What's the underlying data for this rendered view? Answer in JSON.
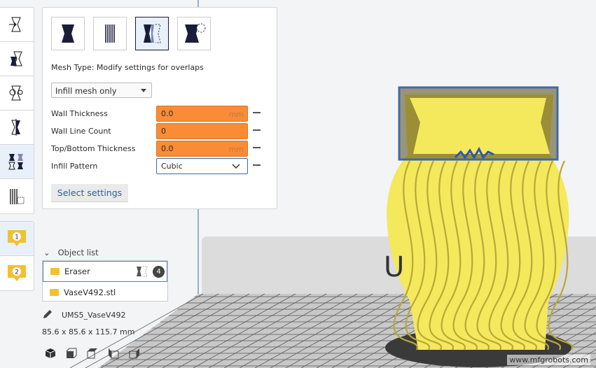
{
  "mesh_panel": {
    "mesh_types": [
      {
        "name": "normal-model",
        "icon": "normal-model-icon"
      },
      {
        "name": "support",
        "icon": "support-mesh-icon"
      },
      {
        "name": "overlaps",
        "icon": "overlap-mesh-icon",
        "selected": true
      },
      {
        "name": "anti-overhang",
        "icon": "anti-overhang-icon"
      }
    ],
    "mesh_type_label": "Mesh Type: Modify settings for overlaps",
    "dropdown_value": "Infill mesh only",
    "settings": [
      {
        "label": "Wall Thickness",
        "value": "0.0",
        "unit": "mm"
      },
      {
        "label": "Wall Line Count",
        "value": "0",
        "unit": ""
      },
      {
        "label": "Top/Bottom Thickness",
        "value": "0.0",
        "unit": "mm"
      },
      {
        "label": "Infill Pattern",
        "value": "Cubic",
        "unit": ""
      }
    ],
    "select_settings_label": "Select settings"
  },
  "toolbar": {
    "tools": [
      "move-icon",
      "scale-icon",
      "rotate-icon",
      "mirror-icon",
      "per-model-settings-icon",
      "support-blocker-icon"
    ],
    "extruders": [
      "1",
      "2"
    ]
  },
  "object_list": {
    "header": "Object list",
    "items": [
      {
        "name": "Eraser",
        "badge": "4",
        "selected": true
      },
      {
        "name": "VaseV492.stl"
      }
    ]
  },
  "job": {
    "name": "UMS5_VaseV492",
    "dimensions": "85.6 x 85.6 x 115.7 mm"
  },
  "view_buttons": [
    "3d-view-icon",
    "front-view-icon",
    "top-view-icon",
    "left-view-icon",
    "right-view-icon"
  ],
  "watermark": "www.mfgrobots.com",
  "colors": {
    "accent": "#3c6ca6",
    "field_override": "#f98c35",
    "model": "#f4e85c",
    "extruder": "#f3c030"
  }
}
